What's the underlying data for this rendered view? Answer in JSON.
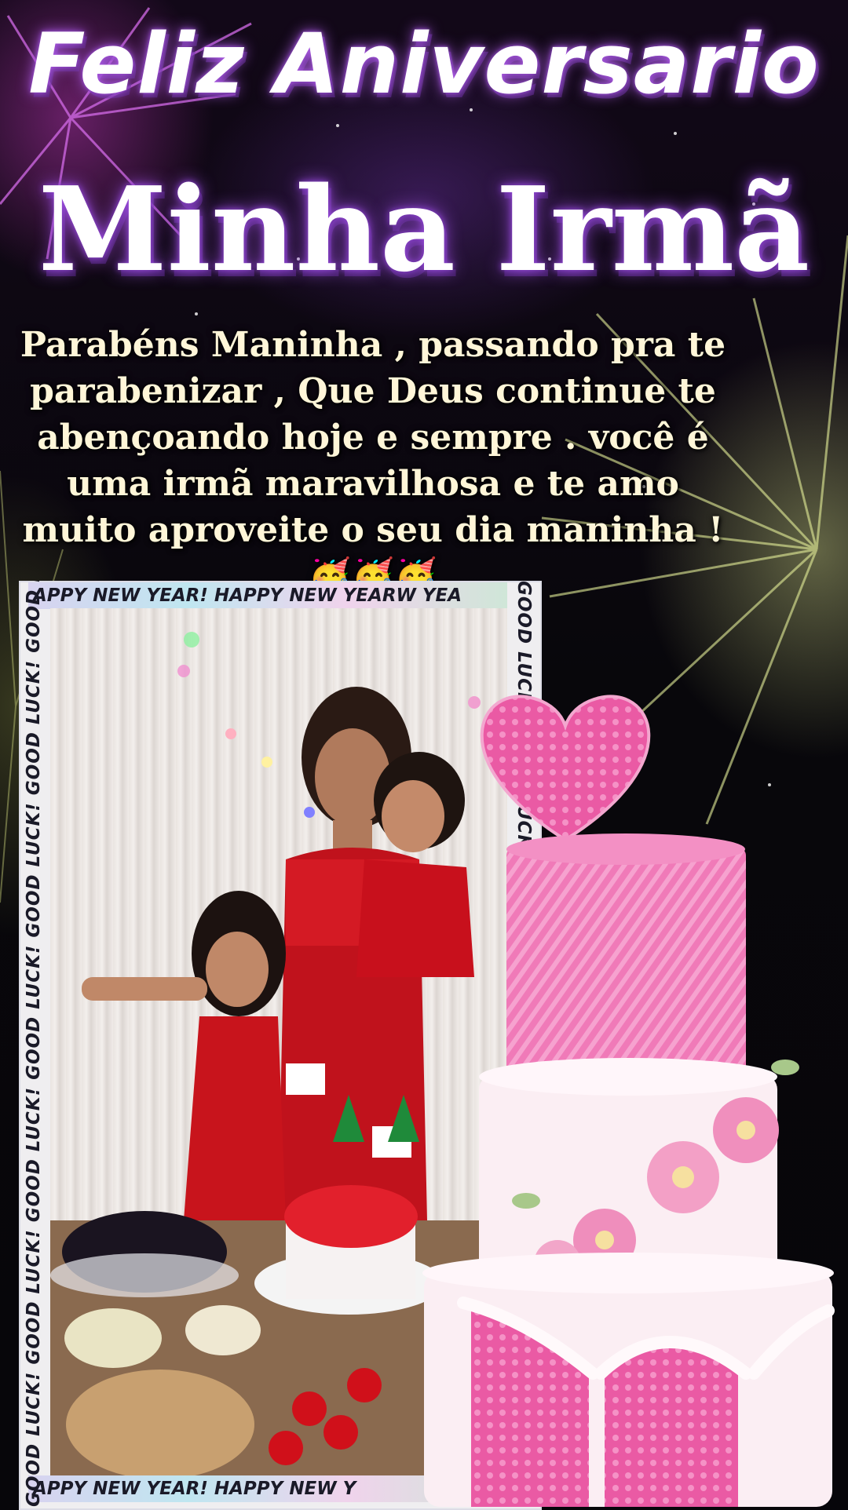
{
  "title_line1": "Feliz Aniversario",
  "title_line2": "Minha Irmã",
  "message_text": "Parabéns Maninha , passando pra te parabenizar , Que Deus continue te abençoando hoje e sempre . você é uma irmã maravilhosa e te amo muito aproveite o seu dia maninha !",
  "message_emojis": "🥳🥳🥳",
  "frame": {
    "top_banner": "APPY NEW YEAR!   HAPPY NEW YEARW YEA",
    "bottom_banner": "APPY NEW YEAR!   HAPPY NEW Y",
    "side_text": "GOOD LUCK!   GOOD LUCK!   GOOD LUCK!   GOOD LUCK!   GOOD LUCK!   GOOD LUCK!   GOOD LUCK!   GOOD LUCK!"
  },
  "colors": {
    "title_glow": "#9f50e0",
    "message_text": "#fff6d8",
    "cake_pink": "#f07ab8",
    "cake_white": "#fbeef3"
  }
}
